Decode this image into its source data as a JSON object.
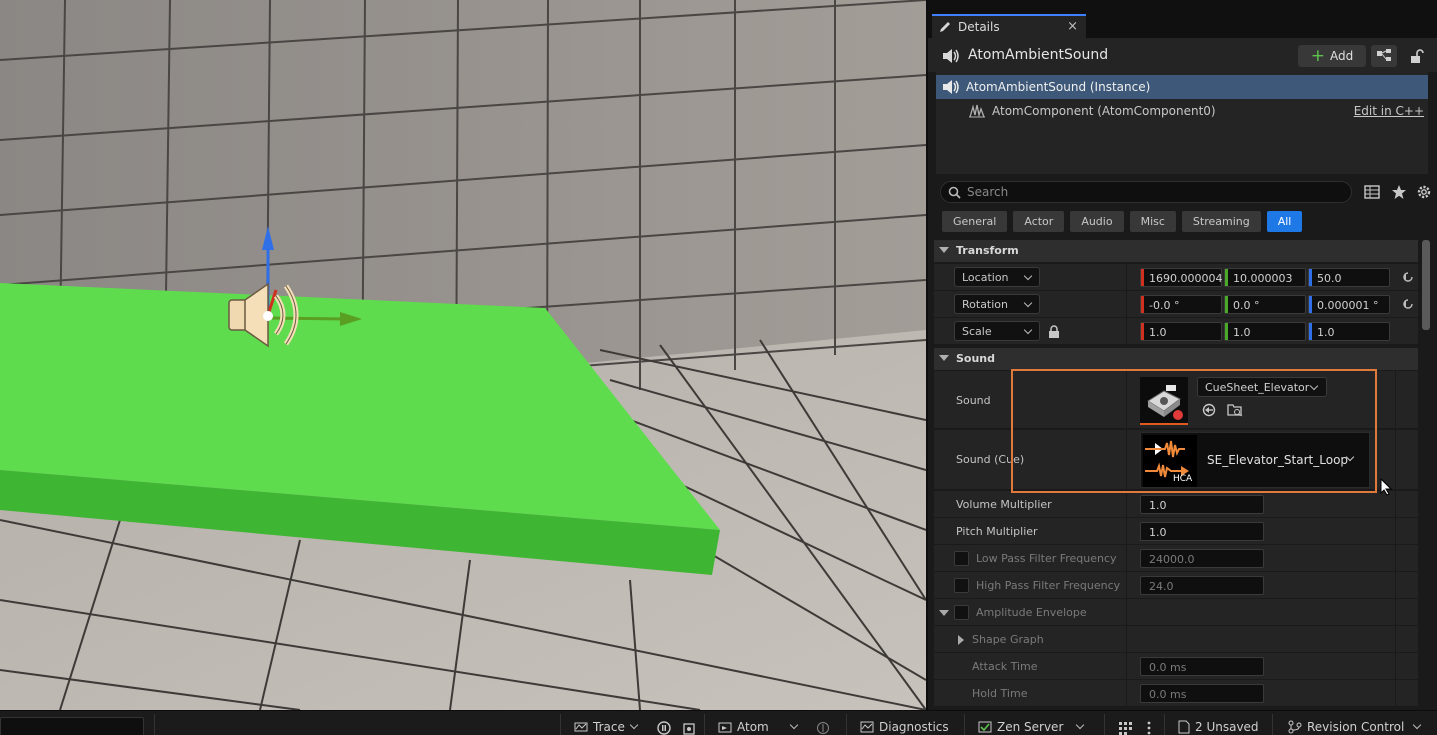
{
  "details": {
    "tab_title": "Details",
    "actor_name": "AtomAmbientSound",
    "add_label": "Add",
    "components": [
      {
        "label": "AtomAmbientSound (Instance)"
      },
      {
        "label": "AtomComponent (AtomComponent0)",
        "link": "Edit in C++"
      }
    ],
    "search": {
      "placeholder": "Search",
      "value": ""
    },
    "filters": [
      "General",
      "Actor",
      "Audio",
      "Misc",
      "Streaming",
      "All"
    ],
    "active_filter": "All",
    "transform": {
      "title": "Transform",
      "location": {
        "label": "Location",
        "x": "1690.000004",
        "y": "10.000003",
        "z": "50.0"
      },
      "rotation": {
        "label": "Rotation",
        "x": "-0.0 °",
        "y": "0.0 °",
        "z": "0.000001 °"
      },
      "scale": {
        "label": "Scale",
        "x": "1.0",
        "y": "1.0",
        "z": "1.0"
      }
    },
    "sound": {
      "title": "Sound",
      "sound_label": "Sound",
      "sound_asset": "CueSheet_Elevator",
      "cue_label": "Sound (Cue)",
      "cue_value": "SE_Elevator_Start_Loop",
      "cue_thumb_text": "HCA",
      "volume": {
        "label": "Volume Multiplier",
        "value": "1.0"
      },
      "pitch": {
        "label": "Pitch Multiplier",
        "value": "1.0"
      },
      "lowpass": {
        "label": "Low Pass Filter Frequency",
        "value": "24000.0"
      },
      "highpass": {
        "label": "High Pass Filter Frequency",
        "value": "24.0"
      },
      "envelope": {
        "label": "Amplitude Envelope"
      },
      "shape_graph": {
        "label": "Shape Graph"
      },
      "attack": {
        "label": "Attack Time",
        "value": "0.0 ms"
      },
      "hold": {
        "label": "Hold Time",
        "value": "0.0 ms"
      }
    }
  },
  "statusbar": {
    "trace": "Trace",
    "atom": "Atom",
    "diagnostics": "Diagnostics",
    "zen": "Zen Server",
    "unsaved": "2 Unsaved",
    "revision": "Revision Control"
  },
  "colors": {
    "accent": "#1e78e6",
    "selection": "#3d5878",
    "highlight": "#e07a3a",
    "floor_green": "#5edc4e"
  }
}
